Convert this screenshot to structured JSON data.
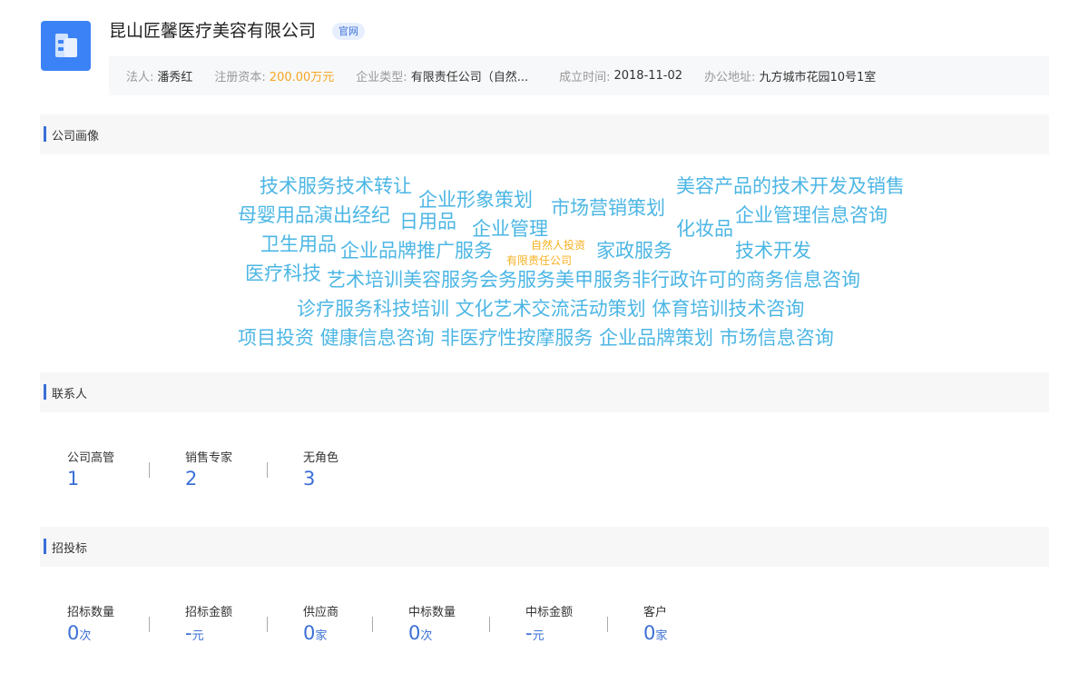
{
  "header": {
    "company_name": "昆山匠馨医疗美容有限公司",
    "official_badge": "官网",
    "info": [
      {
        "label": "法人:",
        "value": "潘秀红"
      },
      {
        "label": "注册资本:",
        "value": "200.00万元"
      },
      {
        "label": "企业类型:",
        "value": "有限责任公司（自然..."
      },
      {
        "label": "成立时间:",
        "value": "2018-11-02"
      },
      {
        "label": "办公地址:",
        "value": "九方城市花园10号1室"
      }
    ]
  },
  "colors": {
    "accent": "#3b6fd6",
    "cloud_word": "#4cb6e4",
    "cloud_small": "#f5b223",
    "capital": "#f5a623"
  },
  "portrait": {
    "title": "公司画像",
    "words": [
      "技术服务技术转让",
      "企业形象策划",
      "市场营销策划",
      "美容产品的技术开发及销售",
      "母婴用品演出经纪",
      "日用品",
      "企业管理",
      "化妆品",
      "企业管理信息咨询",
      "卫生用品",
      "企业品牌推广服务",
      "自然人投资",
      "有限责任公司",
      "家政服务",
      "技术开发",
      "医疗科技",
      "艺术培训美容服务会务服务美甲服务非行政许可的商务信息咨询",
      "诊疗服务科技培训 文化艺术交流活动策划 体育培训技术咨询",
      "项目投资 健康信息咨询 非医疗性按摩服务 企业品牌策划  市场信息咨询"
    ]
  },
  "contacts": {
    "title": "联系人",
    "stats": [
      {
        "label": "公司高管",
        "value": "1",
        "unit": ""
      },
      {
        "label": "销售专家",
        "value": "2",
        "unit": ""
      },
      {
        "label": "无角色",
        "value": "3",
        "unit": ""
      }
    ]
  },
  "bidding": {
    "title": "招投标",
    "stats": [
      {
        "label": "招标数量",
        "value": "0",
        "unit": "次"
      },
      {
        "label": "招标金额",
        "value": "-",
        "unit": "元"
      },
      {
        "label": "供应商",
        "value": "0",
        "unit": "家"
      },
      {
        "label": "中标数量",
        "value": "0",
        "unit": "次"
      },
      {
        "label": "中标金额",
        "value": "-",
        "unit": "元"
      },
      {
        "label": "客户",
        "value": "0",
        "unit": "家"
      }
    ]
  }
}
